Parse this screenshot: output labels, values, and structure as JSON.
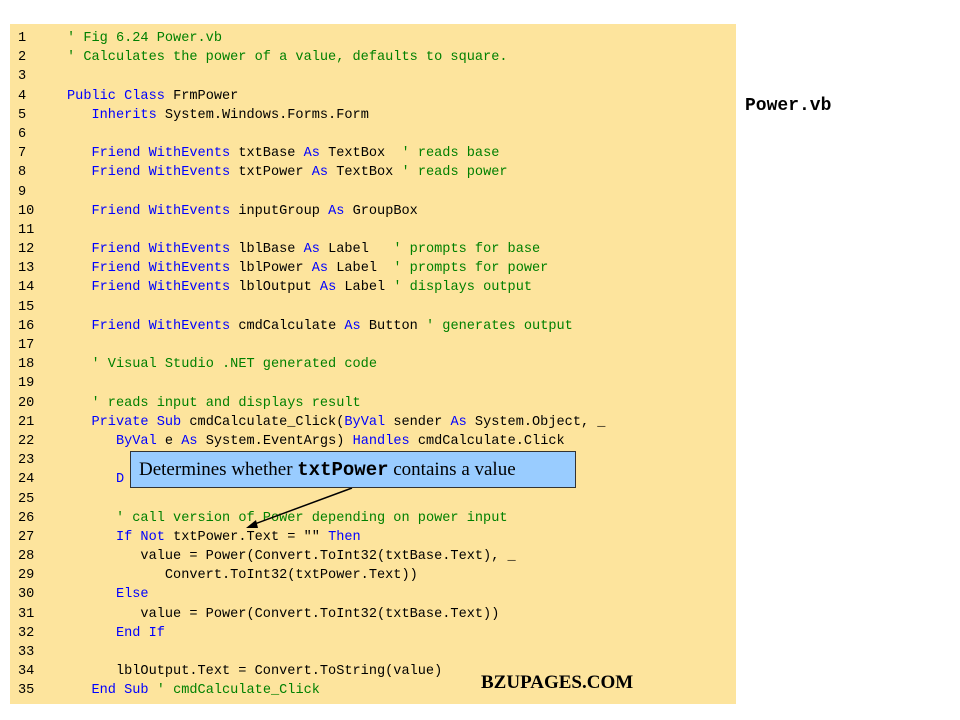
{
  "file_label": "Power.vb",
  "callout": {
    "prefix": "Determines whether ",
    "code": "txtPower",
    "suffix": " contains a value"
  },
  "watermark": "BZUPAGES.COM",
  "colors": {
    "panel": "#fde49d",
    "keyword": "#0000ff",
    "comment": "#008000",
    "callout": "#99ccff"
  },
  "code_lines": [
    {
      "n": "1",
      "segs": [
        [
          "c",
          "' Fig 6.24 Power.vb"
        ]
      ]
    },
    {
      "n": "2",
      "segs": [
        [
          "c",
          "' Calculates the power of a value, defaults to square."
        ]
      ]
    },
    {
      "n": "3",
      "segs": []
    },
    {
      "n": "4",
      "segs": [
        [
          "k",
          "Public Class"
        ],
        [
          "p",
          " FrmPower"
        ]
      ]
    },
    {
      "n": "5",
      "segs": [
        [
          "p",
          "   "
        ],
        [
          "k",
          "Inherits"
        ],
        [
          "p",
          " System.Windows.Forms.Form"
        ]
      ]
    },
    {
      "n": "6",
      "segs": []
    },
    {
      "n": "7",
      "segs": [
        [
          "p",
          "   "
        ],
        [
          "k",
          "Friend WithEvents"
        ],
        [
          "p",
          " txtBase "
        ],
        [
          "k",
          "As"
        ],
        [
          "p",
          " TextBox  "
        ],
        [
          "c",
          "' reads base"
        ]
      ]
    },
    {
      "n": "8",
      "segs": [
        [
          "p",
          "   "
        ],
        [
          "k",
          "Friend WithEvents"
        ],
        [
          "p",
          " txtPower "
        ],
        [
          "k",
          "As"
        ],
        [
          "p",
          " TextBox "
        ],
        [
          "c",
          "' reads power"
        ]
      ]
    },
    {
      "n": "9",
      "segs": []
    },
    {
      "n": "10",
      "segs": [
        [
          "p",
          "   "
        ],
        [
          "k",
          "Friend WithEvents"
        ],
        [
          "p",
          " inputGroup "
        ],
        [
          "k",
          "As"
        ],
        [
          "p",
          " GroupBox"
        ]
      ]
    },
    {
      "n": "11",
      "segs": []
    },
    {
      "n": "12",
      "segs": [
        [
          "p",
          "   "
        ],
        [
          "k",
          "Friend WithEvents"
        ],
        [
          "p",
          " lblBase "
        ],
        [
          "k",
          "As"
        ],
        [
          "p",
          " Label   "
        ],
        [
          "c",
          "' prompts for base"
        ]
      ]
    },
    {
      "n": "13",
      "segs": [
        [
          "p",
          "   "
        ],
        [
          "k",
          "Friend WithEvents"
        ],
        [
          "p",
          " lblPower "
        ],
        [
          "k",
          "As"
        ],
        [
          "p",
          " Label  "
        ],
        [
          "c",
          "' prompts for power"
        ]
      ]
    },
    {
      "n": "14",
      "segs": [
        [
          "p",
          "   "
        ],
        [
          "k",
          "Friend WithEvents"
        ],
        [
          "p",
          " lblOutput "
        ],
        [
          "k",
          "As"
        ],
        [
          "p",
          " Label "
        ],
        [
          "c",
          "' displays output"
        ]
      ]
    },
    {
      "n": "15",
      "segs": []
    },
    {
      "n": "16",
      "segs": [
        [
          "p",
          "   "
        ],
        [
          "k",
          "Friend WithEvents"
        ],
        [
          "p",
          " cmdCalculate "
        ],
        [
          "k",
          "As"
        ],
        [
          "p",
          " Button "
        ],
        [
          "c",
          "' generates output"
        ]
      ]
    },
    {
      "n": "17",
      "segs": []
    },
    {
      "n": "18",
      "segs": [
        [
          "p",
          "   "
        ],
        [
          "c",
          "' Visual Studio .NET generated code"
        ]
      ]
    },
    {
      "n": "19",
      "segs": []
    },
    {
      "n": "20",
      "segs": [
        [
          "p",
          "   "
        ],
        [
          "c",
          "' reads input and displays result"
        ]
      ]
    },
    {
      "n": "21",
      "segs": [
        [
          "p",
          "   "
        ],
        [
          "k",
          "Private Sub"
        ],
        [
          "p",
          " cmdCalculate_Click("
        ],
        [
          "k",
          "ByVal"
        ],
        [
          "p",
          " sender "
        ],
        [
          "k",
          "As"
        ],
        [
          "p",
          " System.Object, _"
        ]
      ]
    },
    {
      "n": "22",
      "segs": [
        [
          "p",
          "      "
        ],
        [
          "k",
          "ByVal"
        ],
        [
          "p",
          " e "
        ],
        [
          "k",
          "As"
        ],
        [
          "p",
          " System.EventArgs) "
        ],
        [
          "k",
          "Handles"
        ],
        [
          "p",
          " cmdCalculate.Click"
        ]
      ]
    },
    {
      "n": "23",
      "segs": []
    },
    {
      "n": "24",
      "segs": [
        [
          "p",
          "      "
        ],
        [
          "k",
          "D"
        ]
      ]
    },
    {
      "n": "25",
      "segs": []
    },
    {
      "n": "26",
      "segs": [
        [
          "p",
          "      "
        ],
        [
          "c",
          "' call version of Power depending on power input"
        ]
      ]
    },
    {
      "n": "27",
      "segs": [
        [
          "p",
          "      "
        ],
        [
          "k",
          "If Not"
        ],
        [
          "p",
          " txtPower.Text = \"\" "
        ],
        [
          "k",
          "Then"
        ]
      ]
    },
    {
      "n": "28",
      "segs": [
        [
          "p",
          "         value = Power(Convert.ToInt32(txtBase.Text), _"
        ]
      ]
    },
    {
      "n": "29",
      "segs": [
        [
          "p",
          "            Convert.ToInt32(txtPower.Text))"
        ]
      ]
    },
    {
      "n": "30",
      "segs": [
        [
          "p",
          "      "
        ],
        [
          "k",
          "Else"
        ]
      ]
    },
    {
      "n": "31",
      "segs": [
        [
          "p",
          "         value = Power(Convert.ToInt32(txtBase.Text))"
        ]
      ]
    },
    {
      "n": "32",
      "segs": [
        [
          "p",
          "      "
        ],
        [
          "k",
          "End If"
        ]
      ]
    },
    {
      "n": "33",
      "segs": []
    },
    {
      "n": "34",
      "segs": [
        [
          "p",
          "      lblOutput.Text = Convert.ToString(value)"
        ]
      ]
    },
    {
      "n": "35",
      "segs": [
        [
          "p",
          "   "
        ],
        [
          "k",
          "End Sub"
        ],
        [
          "p",
          " "
        ],
        [
          "c",
          "' cmdCalculate_Click"
        ]
      ]
    }
  ]
}
